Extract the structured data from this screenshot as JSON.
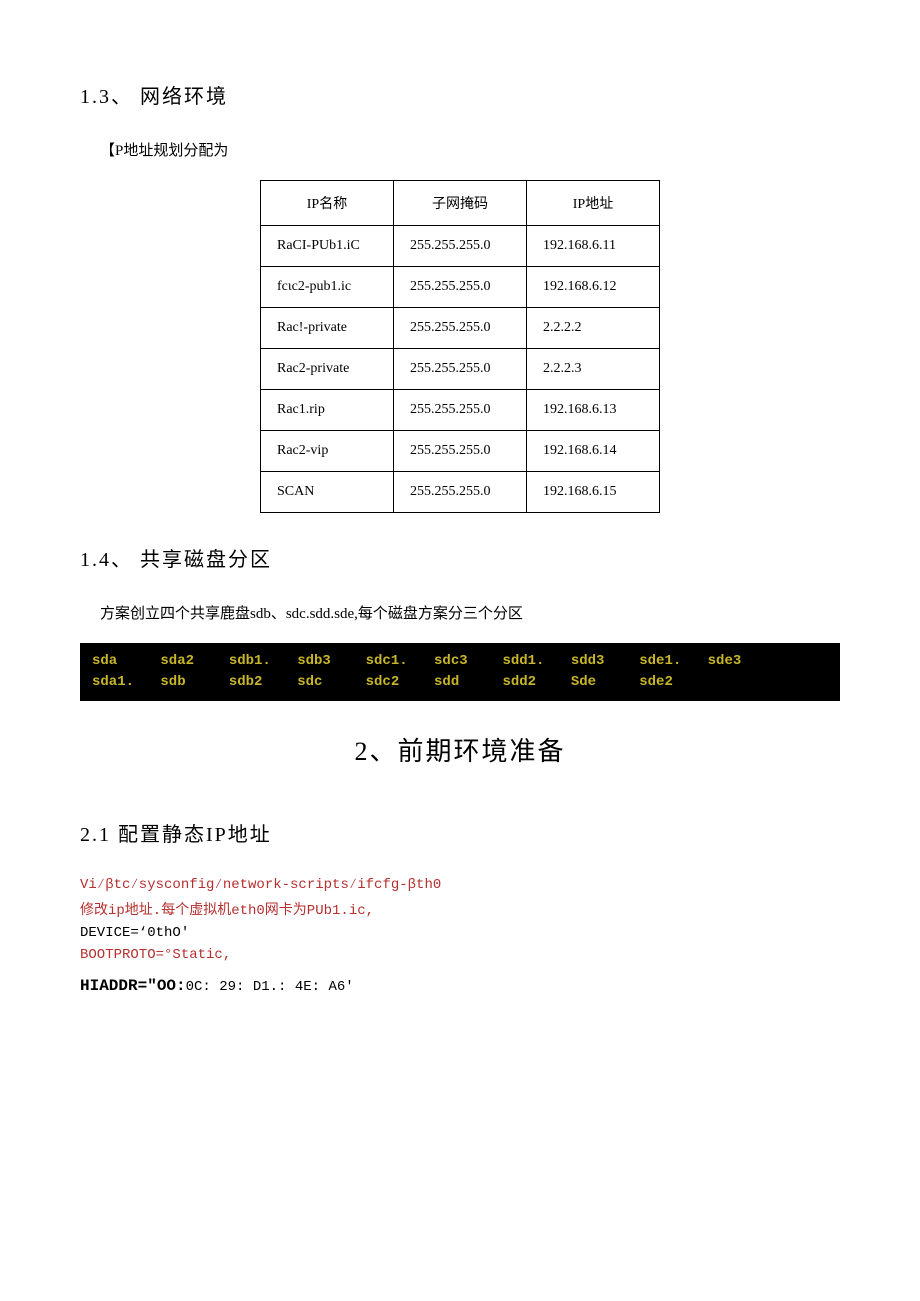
{
  "sec13": {
    "heading": "1.3、 网络环境",
    "intro": "【P地址规划分配为",
    "table": {
      "headers": [
        "IP名称",
        "子网掩码",
        "IP地址"
      ],
      "rows": [
        [
          "RaCI-PUb1.iC",
          "255.255.255.0",
          "192.168.6.11"
        ],
        [
          "fcιc2-pub1.ic",
          "255.255.255.0",
          "192.168.6.12"
        ],
        [
          "Rac!-private",
          "255.255.255.0",
          "2.2.2.2"
        ],
        [
          "Rac2-private",
          "255.255.255.0",
          "2.2.2.3"
        ],
        [
          "Rac1.rip",
          "255.255.255.0",
          "192.168.6.13"
        ],
        [
          "Rac2-vip",
          "255.255.255.0",
          "192.168.6.14"
        ],
        [
          "SCAN",
          "255.255.255.0",
          "192.168.6.15"
        ]
      ]
    }
  },
  "sec14": {
    "heading": "1.4、 共享磁盘分区",
    "intro": "方案创立四个共享鹿盘sdb、sdc.sdd.sde,每个磁盘方案分三个分区",
    "disks_row1": [
      "sda",
      "sda2",
      "sdb1.",
      "sdb3",
      "sdc1.",
      "sdc3",
      "sdd1.",
      "sdd3",
      "sde1.",
      "sde3"
    ],
    "disks_row2": [
      "sda1.",
      "sdb",
      "sdb2",
      "sdc",
      "sdc2",
      "sdd",
      "sdd2",
      "Sde",
      "sde2"
    ]
  },
  "sec2": {
    "heading": "2、前期环境准备"
  },
  "sec21": {
    "heading": "2.1  配置静态IP地址",
    "line1": "Vi∕βtc∕sysconfig∕network-scripts∕ifcfg-βth0",
    "line2": "修改ip地址.每个虚拟机eth0网卡为PUb1.ic,",
    "line3": "DEVICE=‘0thO'",
    "line4": "BOOTPROTO=°Static,",
    "hwaddr_bold": "HIADDR=\"OO:",
    "hwaddr_rest": "0C: 29: D1.: 4E: A6'"
  }
}
